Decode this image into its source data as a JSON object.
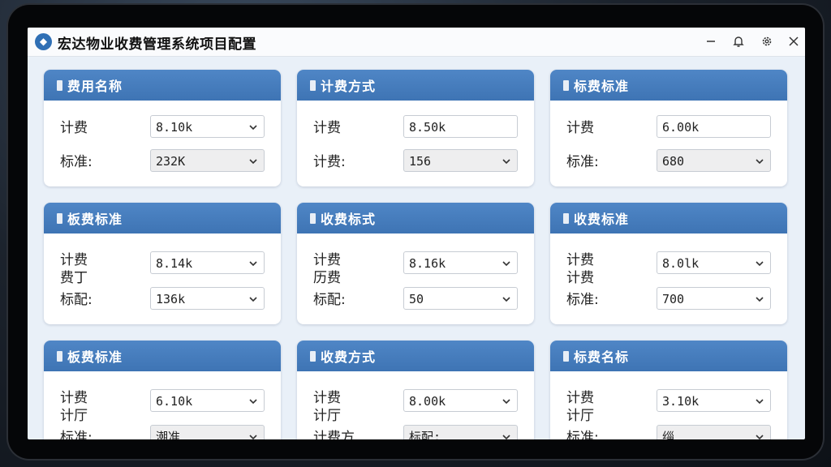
{
  "window": {
    "title": "宏达物业收费管理系统项目配置",
    "icons": {
      "app": "app-logo-icon",
      "bell": "bell-icon",
      "settings": "gear-icon",
      "close": "close-icon"
    }
  },
  "colors": {
    "header": "#3e74b4",
    "background": "#e9f0f8",
    "card": "#ffffff"
  },
  "cards": [
    {
      "title": "费用名称",
      "rows": [
        {
          "label": "计费",
          "value": "8.10k",
          "dropdown": true,
          "filled": false
        },
        {
          "label": "标准:",
          "value": "232K",
          "dropdown": true,
          "filled": true
        }
      ]
    },
    {
      "title": "计费方式",
      "rows": [
        {
          "label": "计费",
          "value": "8.50k",
          "dropdown": false,
          "filled": false
        },
        {
          "label": "计费:",
          "value": "156",
          "dropdown": true,
          "filled": true
        }
      ]
    },
    {
      "title": "标费标准",
      "rows": [
        {
          "label": "计费",
          "value": "6.00k",
          "dropdown": false,
          "filled": false
        },
        {
          "label": "标准:",
          "value": "680",
          "dropdown": true,
          "filled": true
        }
      ]
    },
    {
      "title": "板费标准",
      "rows": [
        {
          "label": "计费\n费丁",
          "value": "8.14k",
          "dropdown": true,
          "filled": false
        },
        {
          "label": "标配:",
          "value": "136k",
          "dropdown": true,
          "filled": false
        }
      ]
    },
    {
      "title": "收费标式",
      "rows": [
        {
          "label": "计费\n历费",
          "value": "8.16k",
          "dropdown": true,
          "filled": false
        },
        {
          "label": "标配:",
          "value": "50",
          "dropdown": true,
          "filled": false
        }
      ]
    },
    {
      "title": "收费标准",
      "rows": [
        {
          "label": "计费\n计费",
          "value": "8.0lk",
          "dropdown": true,
          "filled": false
        },
        {
          "label": "标准:",
          "value": "700",
          "dropdown": true,
          "filled": false
        }
      ]
    },
    {
      "title": "板费标准",
      "rows": [
        {
          "label": "计费\n计厅",
          "value": "6.10k",
          "dropdown": true,
          "filled": false
        },
        {
          "label": "标准:",
          "value": "潮准",
          "dropdown": true,
          "filled": true
        }
      ]
    },
    {
      "title": "收费方式",
      "rows": [
        {
          "label": "计费\n计厅",
          "value": "8.00k",
          "dropdown": true,
          "filled": false
        },
        {
          "label": "计费方",
          "value": "标配:",
          "dropdown": true,
          "filled": true
        }
      ]
    },
    {
      "title": "标费名标",
      "rows": [
        {
          "label": "计费\n计厅",
          "value": "3.10k",
          "dropdown": true,
          "filled": false
        },
        {
          "label": "标准:",
          "value": "缁",
          "dropdown": true,
          "filled": true
        }
      ]
    }
  ]
}
